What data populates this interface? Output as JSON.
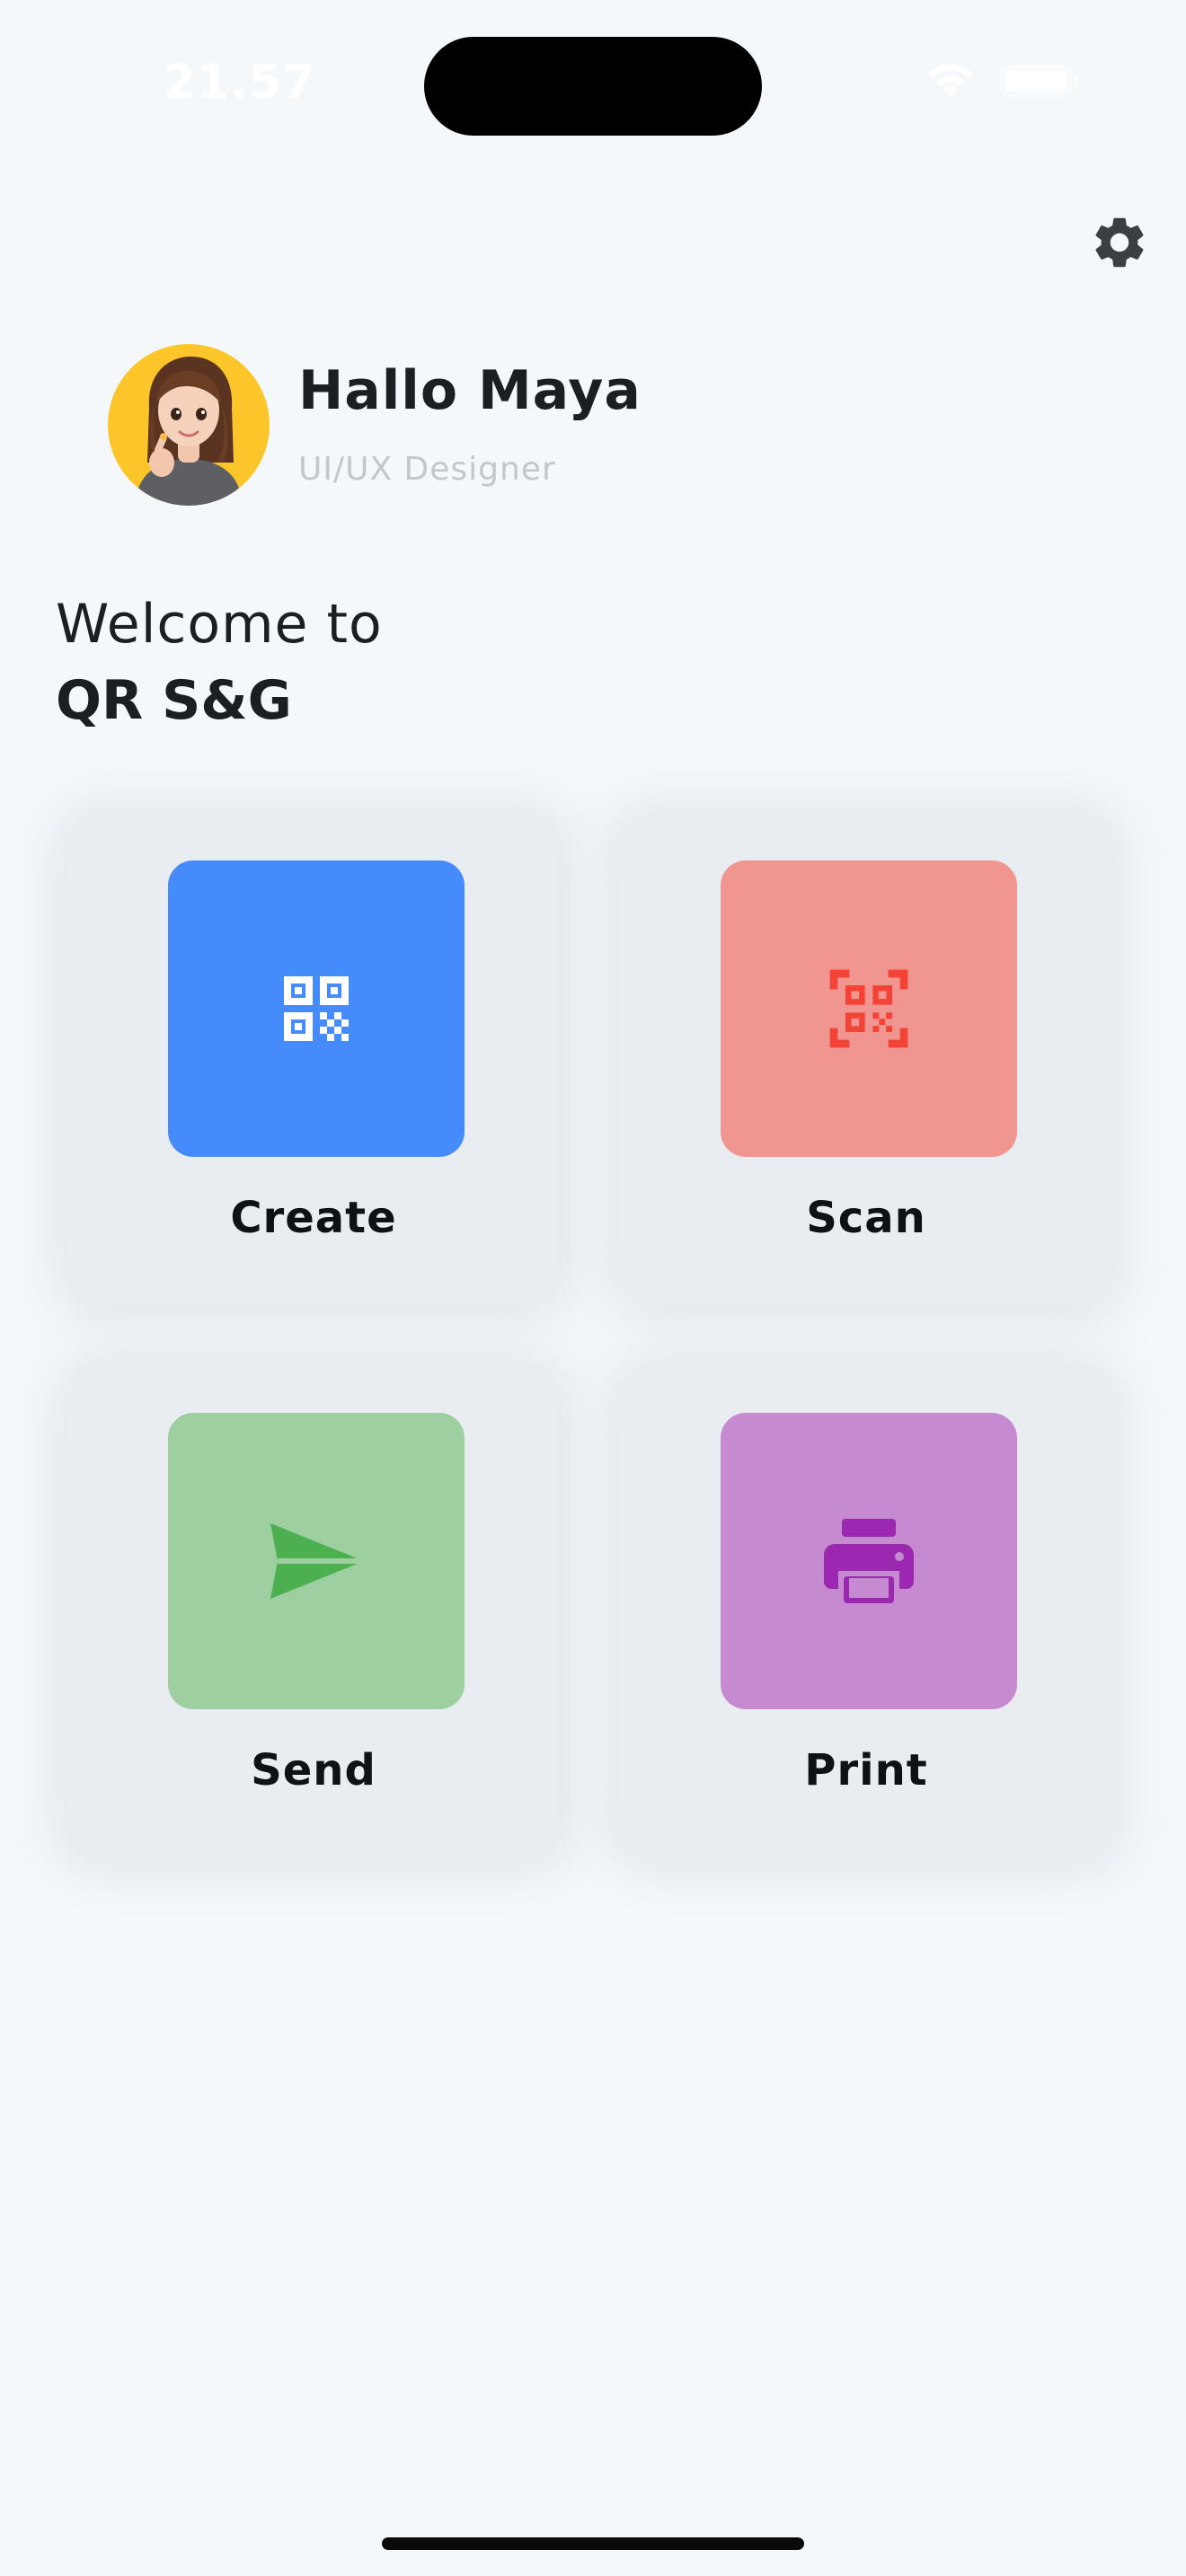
{
  "status": {
    "time": "21.57"
  },
  "profile": {
    "greeting": "Hallo Maya",
    "role": "UI/UX Designer"
  },
  "welcome": {
    "line1": "Welcome to",
    "app_name": "QR S&G"
  },
  "actions": [
    {
      "label": "Create",
      "icon": "qr-code-icon",
      "tile_color": "#458bfc",
      "icon_color": "#ffffff"
    },
    {
      "label": "Scan",
      "icon": "qr-scan-icon",
      "tile_color": "#f09590",
      "icon_color": "#f24336"
    },
    {
      "label": "Send",
      "icon": "send-icon",
      "tile_color": "#9dcfa0",
      "icon_color": "#4caf50"
    },
    {
      "label": "Print",
      "icon": "print-icon",
      "tile_color": "#c58acf",
      "icon_color": "#9c27b0"
    }
  ],
  "colors": {
    "background": "#f5f8fb",
    "card": "#e9ecf0",
    "avatar_bg": "#fcc62a"
  }
}
